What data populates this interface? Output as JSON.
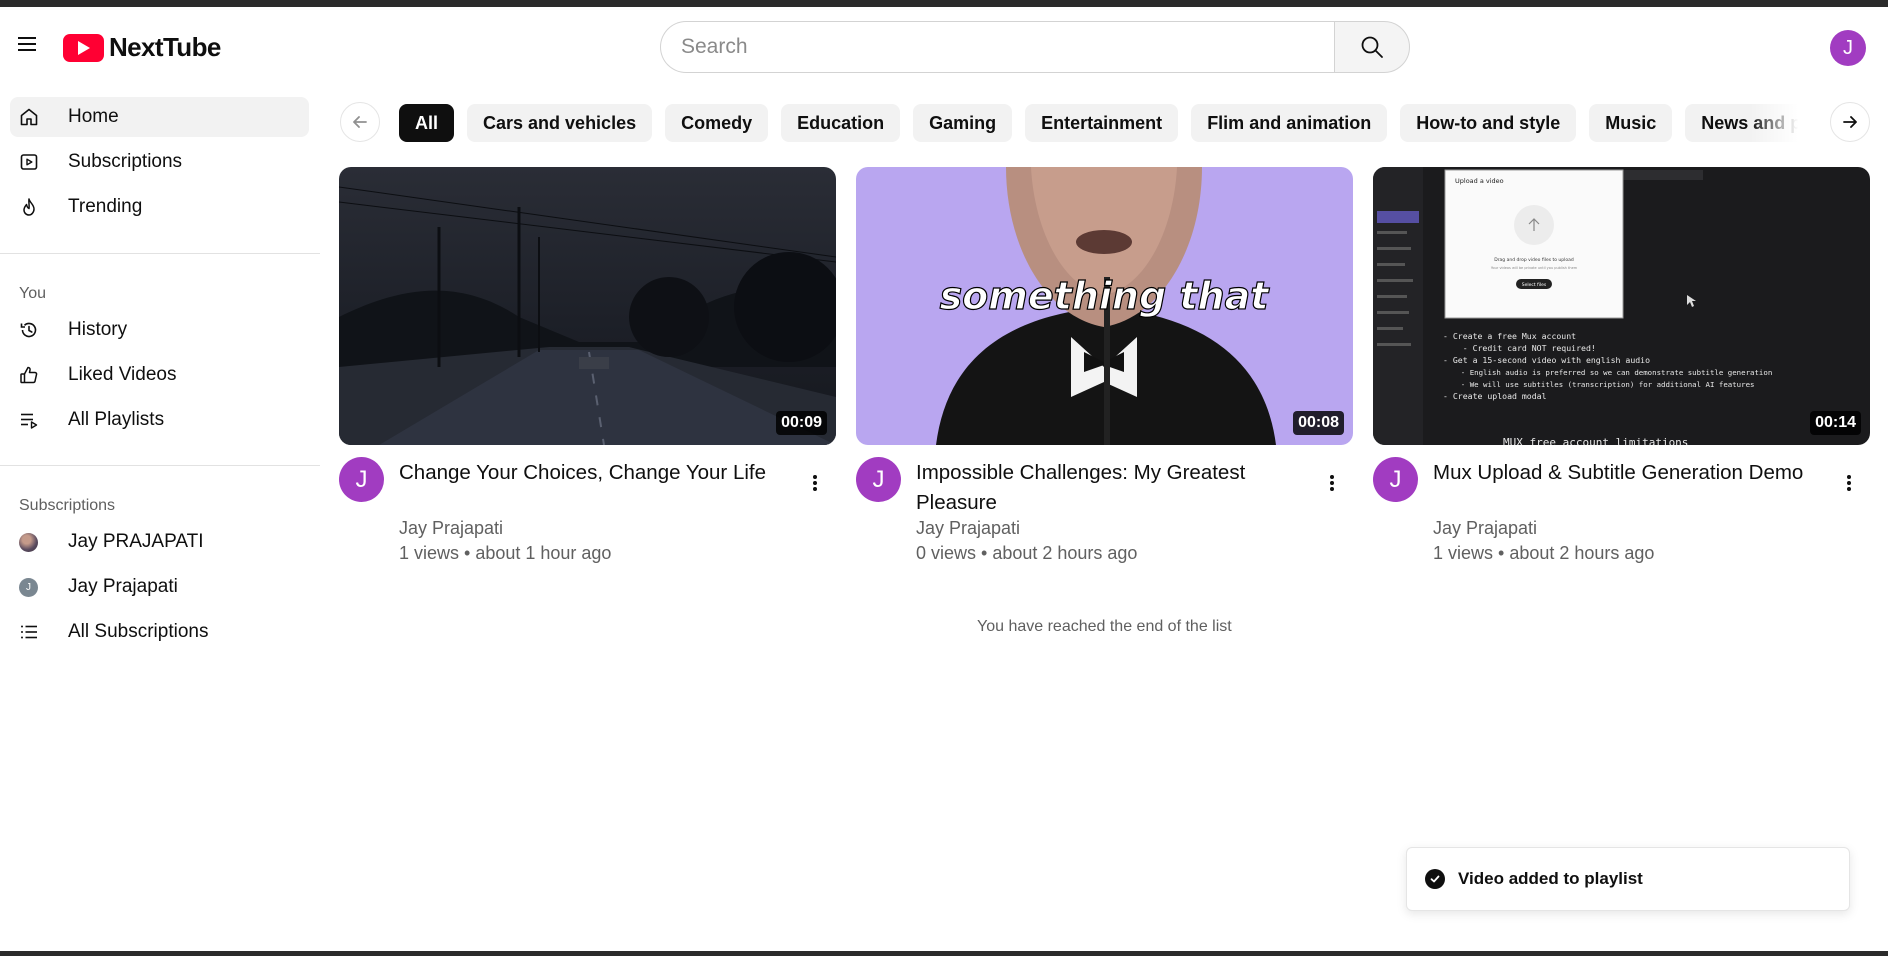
{
  "header": {
    "brand": "NextTube",
    "search_placeholder": "Search",
    "user_initial": "J"
  },
  "sidebar": {
    "main": [
      {
        "label": "Home",
        "icon": "home-icon",
        "active": true
      },
      {
        "label": "Subscriptions",
        "icon": "subscriptions-icon"
      },
      {
        "label": "Trending",
        "icon": "flame-icon"
      }
    ],
    "you_title": "You",
    "you": [
      {
        "label": "History",
        "icon": "history-icon"
      },
      {
        "label": "Liked Videos",
        "icon": "thumbs-up-icon"
      },
      {
        "label": "All Playlists",
        "icon": "playlist-icon"
      }
    ],
    "subs_title": "Subscriptions",
    "subs": [
      {
        "label": "Jay PRAJAPATI",
        "avatar_initial": ""
      },
      {
        "label": "Jay Prajapati",
        "avatar_initial": "J"
      },
      {
        "label": "All Subscriptions",
        "icon": "list-icon"
      }
    ]
  },
  "chips": [
    "All",
    "Cars and vehicles",
    "Comedy",
    "Education",
    "Gaming",
    "Entertainment",
    "Flim and animation",
    "How-to and style",
    "Music",
    "News and politics"
  ],
  "videos": [
    {
      "title": "Change Your Choices, Change Your Life",
      "channel": "Jay Prajapati",
      "meta": "1 views • about 1 hour ago",
      "duration": "00:09",
      "avatar": "J"
    },
    {
      "title": "Impossible Challenges: My Greatest Pleasure",
      "channel": "Jay Prajapati",
      "meta": "0 views • about 2 hours ago",
      "duration": "00:08",
      "avatar": "J",
      "caption": "something that"
    },
    {
      "title": "Mux Upload & Subtitle Generation Demo",
      "channel": "Jay Prajapati",
      "meta": "1 views • about 2 hours ago",
      "duration": "00:14",
      "avatar": "J",
      "screen": {
        "dialog_title": "Upload a video",
        "drop_text": "Drag and drop video files to upload",
        "drop_hint": "Your videos will be private until you publish them",
        "select_label": "Select files",
        "notes": [
          "- Create a free Mux account",
          "    - Credit card NOT required!",
          "- Get a 15-second video with english audio",
          "    - English audio is preferred so we can demonstrate subtitle generation",
          "    - We will use subtitles (transcription) for additional AI features",
          "- Create upload modal",
          "MUX free account limitations"
        ]
      }
    }
  ],
  "end_text": "You have reached the end of the list",
  "toast": {
    "message": "Video added to playlist"
  },
  "colors": {
    "brand_red": "#ff0033",
    "avatar_purple": "#a13cc1",
    "chip_bg": "#f2f2f2",
    "chip_selected": "#0f0f0f"
  }
}
